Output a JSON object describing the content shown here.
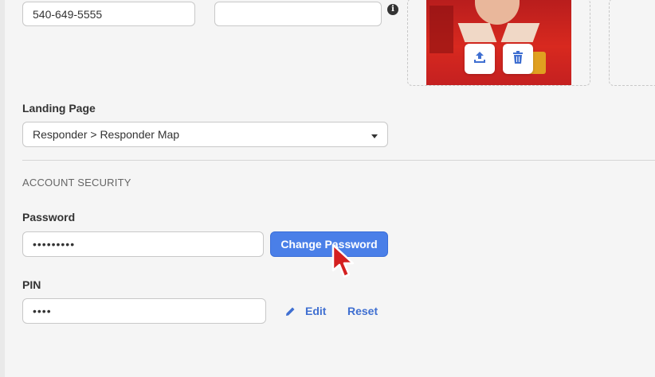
{
  "contact": {
    "phone_value": "540-649-5555",
    "second_value": ""
  },
  "photo": {
    "upload_icon": "upload-icon",
    "delete_icon": "trash-icon"
  },
  "landing": {
    "label": "Landing Page",
    "selected": "Responder > Responder Map"
  },
  "security": {
    "title": "ACCOUNT SECURITY",
    "password_label": "Password",
    "password_value": "•••••••••",
    "change_password_label": "Change Password",
    "pin_label": "PIN",
    "pin_value": "••••",
    "edit_label": "Edit",
    "reset_label": "Reset"
  },
  "colors": {
    "primary": "#4a7fe8",
    "link": "#3f6fd1",
    "cursor": "#d42020"
  }
}
